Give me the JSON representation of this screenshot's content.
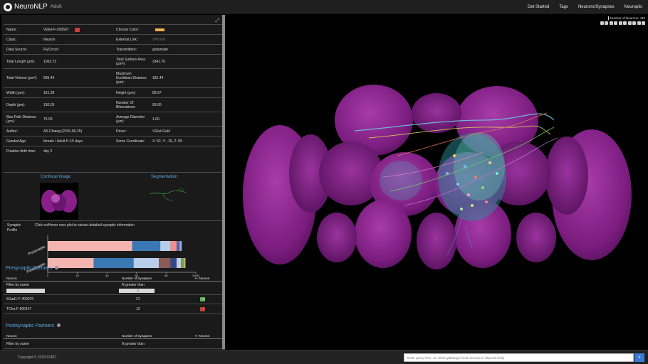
{
  "app": {
    "brand": "NeuroNLP",
    "subtitle": "Adult"
  },
  "nav": {
    "items": [
      "Get Started",
      "Tags",
      "Neurons/Synapses",
      "Neuropils"
    ]
  },
  "info": {
    "rows": [
      {
        "k1": "Name :",
        "v1": "VGlut-F-200597",
        "k2": "Choose Color:",
        "v2": ""
      },
      {
        "k1": "Class:",
        "v1": "Neuron",
        "k2": "External Link:",
        "v2": "VFB link"
      },
      {
        "k1": "Data Source:",
        "v1": "FlyCircuit",
        "k2": "Transmitters:",
        "v2": "glutamate"
      },
      {
        "k1": "Total Length (μm):",
        "v1": "1063.72",
        "k2": "Total Surface Area (μm²):",
        "v2": "3341.76"
      },
      {
        "k1": "Total Volume (μm³):",
        "v1": "835.44",
        "k2": "Maximum Euclidean Distance (μm):",
        "v2": "182.44"
      },
      {
        "k1": "Width (μm):",
        "v1": "151.39",
        "k2": "Height (μm):",
        "v2": "89.97"
      },
      {
        "k1": "Depth (μm):",
        "v1": "130.03",
        "k2": "Number Of Bifurcations:",
        "v2": "69.00"
      },
      {
        "k1": "Max Path Distance (μm):",
        "v1": "75.00",
        "k2": "Average Diameter (μm):",
        "v2": "1.00"
      },
      {
        "k1": "Author:",
        "v1": "AS Chiang (2015-06-25)",
        "k2": "Driver:",
        "v2": "VGlut-Gal4"
      },
      {
        "k1": "Gender/Age:",
        "v1": "female / Adult 5~15 days",
        "k2": "Soma Coordinate:",
        "v2": "X: 52, Y: -15, Z: 99"
      },
      {
        "k1": "Putative birth time:",
        "v1": "day 2",
        "k2": "",
        "v2": ""
      }
    ],
    "choose_color": "#f0b24a"
  },
  "images": {
    "confocal_title": "Confocal Image",
    "segmentation_title": "Segmentation"
  },
  "profile": {
    "label_line1": "Synaptic",
    "label_line2": "Profile",
    "hint": "Click on/Hover over plot to extract detailed synaptic information",
    "categories": [
      "Presynaptic",
      "Postsynaptic"
    ],
    "ticks": [
      "0",
      "20",
      "40",
      "60",
      "80",
      "100%"
    ],
    "segments": [
      [
        {
          "value": 57,
          "color": "#f4b5b0"
        },
        {
          "value": 19,
          "color": "#3a78b4"
        },
        {
          "value": 7,
          "color": "#b7cde9"
        },
        {
          "value": 4,
          "color": "#f08f8b"
        },
        {
          "value": 2,
          "color": "#5a5fa6"
        },
        {
          "value": 1.5,
          "color": "#8ab1d8"
        }
      ],
      [
        {
          "value": 31,
          "color": "#f4b5b0"
        },
        {
          "value": 27,
          "color": "#3a78b4"
        },
        {
          "value": 17,
          "color": "#b7cde9"
        },
        {
          "value": 8,
          "color": "#8a5a55"
        },
        {
          "value": 4,
          "color": "#2e4a8a"
        },
        {
          "value": 3,
          "color": "#c8c8e8"
        },
        {
          "value": 2,
          "color": "#6da855"
        },
        {
          "value": 1,
          "color": "#e0b060"
        }
      ]
    ]
  },
  "presyn": {
    "title": "Presynaptic Partners",
    "headers": [
      "Neuron",
      "Number of Synapses",
      "+/- Neuron"
    ],
    "filter_name": "Filter by name",
    "filter_num": "N greater than",
    "filter_num_value": "0",
    "rows": [
      {
        "neuron": "5Gad1-F-400376",
        "count": "21",
        "action": "+"
      },
      {
        "neuron": "TCha-F-500147",
        "count": "12",
        "action": "-"
      }
    ]
  },
  "postsyn": {
    "title": "Postsynaptic Partners",
    "headers": [
      "Neuron",
      "Number of Synapses",
      "+/- Neuron"
    ],
    "filter_name": "Filter by name",
    "filter_num": "N greater than"
  },
  "viewport": {
    "neuron_count": "Number of Neurons: 445"
  },
  "footer": {
    "copyright": "Copyright © 2018 FFBO",
    "query_placeholder": "Enter query here, ex. show gabaergic local neurons in ellipsoid body"
  }
}
